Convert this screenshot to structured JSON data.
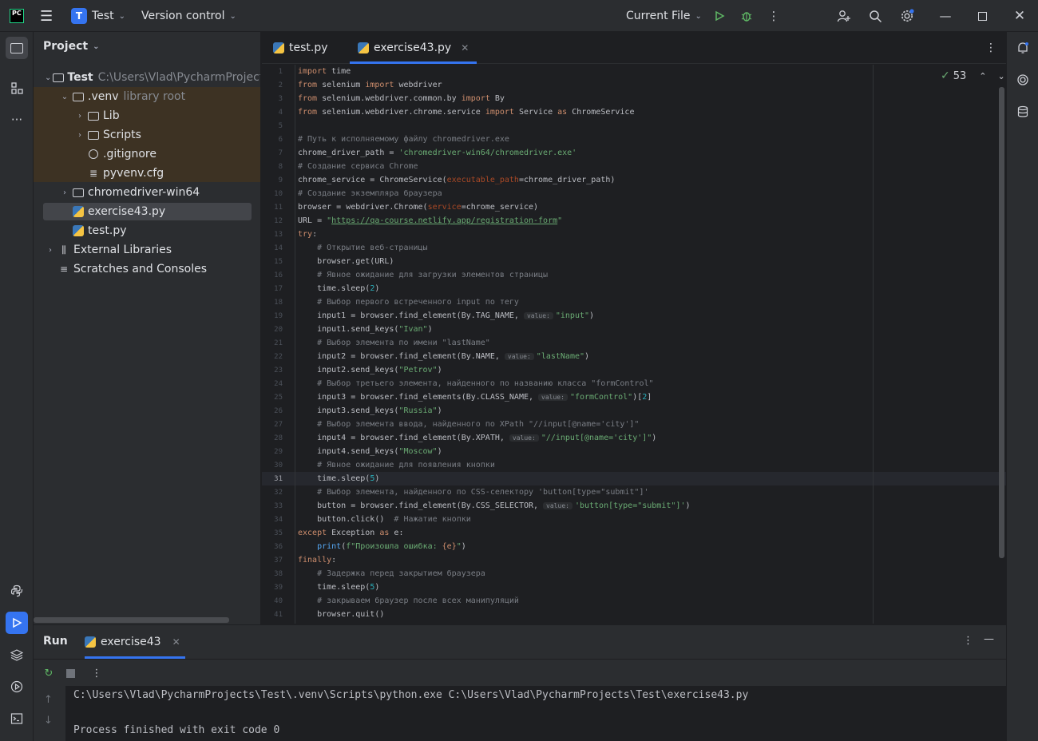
{
  "titlebar": {
    "logo": "PC",
    "project_badge": "T",
    "project_name": "Test",
    "vcs": "Version control",
    "run_config": "Current File"
  },
  "project_panel": {
    "header": "Project",
    "items": [
      {
        "label": "Test",
        "extra": "C:\\Users\\Vlad\\PycharmProjects\\Test"
      },
      {
        "label": ".venv",
        "extra": "library root"
      },
      {
        "label": "Lib"
      },
      {
        "label": "Scripts"
      },
      {
        "label": ".gitignore"
      },
      {
        "label": "pyvenv.cfg"
      },
      {
        "label": "chromedriver-win64"
      },
      {
        "label": "exercise43.py"
      },
      {
        "label": "test.py"
      },
      {
        "label": "External Libraries"
      },
      {
        "label": "Scratches and Consoles"
      }
    ]
  },
  "tabs": [
    {
      "label": "test.py"
    },
    {
      "label": "exercise43.py"
    }
  ],
  "editor": {
    "problems_count": "53",
    "current_line": 31,
    "line_numbers": [
      "1",
      "2",
      "3",
      "4",
      "5",
      "6",
      "7",
      "8",
      "9",
      "10",
      "11",
      "12",
      "13",
      "14",
      "15",
      "16",
      "17",
      "18",
      "19",
      "20",
      "21",
      "22",
      "23",
      "24",
      "25",
      "26",
      "27",
      "28",
      "29",
      "30",
      "31",
      "32",
      "33",
      "34",
      "35",
      "36",
      "37",
      "38",
      "39",
      "40",
      "41"
    ],
    "code": {
      "l1a": "import",
      "l1b": " time",
      "l2a": "from",
      "l2b": " selenium ",
      "l2c": "import",
      "l2d": " webdriver",
      "l3a": "from",
      "l3b": " selenium.webdriver.common.by ",
      "l3c": "import",
      "l3d": " By",
      "l4a": "from",
      "l4b": " selenium.webdriver.chrome.service ",
      "l4c": "import",
      "l4d": " Service ",
      "l4e": "as",
      "l4f": " ChromeService",
      "l6": "# Путь к исполняемому файлу chromedriver.exe",
      "l7a": "chrome_driver_path = ",
      "l7b": "'chromedriver-win64/chromedriver.exe'",
      "l8": "# Создание сервиса Chrome",
      "l9a": "chrome_service = ChromeService(",
      "l9b": "executable_path",
      "l9c": "=chrome_driver_path)",
      "l10": "# Создание экземпляра браузера",
      "l11a": "browser = webdriver.Chrome(",
      "l11b": "service",
      "l11c": "=chrome_service)",
      "l12a": "URL = ",
      "l12b": "\"",
      "l12c": "https://qa-course.netlify.app/registration-form",
      "l12d": "\"",
      "l13a": "try",
      "l13b": ":",
      "l14": "    # Открытие веб-страницы",
      "l15": "    browser.get(URL)",
      "l16": "    # Явное ожидание для загрузки элементов страницы",
      "l17a": "    time.sleep(",
      "l17b": "2",
      "l17c": ")",
      "l18": "    # Выбор первого встреченного input по тегу",
      "l19a": "    input1 = browser.find_element(By.TAG_NAME, ",
      "l19b": "value:",
      "l19c": "\"input\"",
      "l19d": ")",
      "l20a": "    input1.send_keys(",
      "l20b": "\"Ivan\"",
      "l20c": ")",
      "l21": "    # Выбор элемента по имени \"lastName\"",
      "l22a": "    input2 = browser.find_element(By.NAME, ",
      "l22b": "value:",
      "l22c": "\"lastName\"",
      "l22d": ")",
      "l23a": "    input2.send_keys(",
      "l23b": "\"Petrov\"",
      "l23c": ")",
      "l24": "    # Выбор третьего элемента, найденного по названию класса \"formControl\"",
      "l25a": "    input3 = browser.find_elements(By.CLASS_NAME, ",
      "l25b": "value:",
      "l25c": "\"formControl\"",
      "l25d": ")[",
      "l25e": "2",
      "l25f": "]",
      "l26a": "    input3.send_keys(",
      "l26b": "\"Russia\"",
      "l26c": ")",
      "l27": "    # Выбор элемента ввода, найденного по XPath \"//input[@name='city']\"",
      "l28a": "    input4 = browser.find_element(By.XPATH, ",
      "l28b": "value:",
      "l28c": "\"//input[@name='city']\"",
      "l28d": ")",
      "l29a": "    input4.send_keys(",
      "l29b": "\"Moscow\"",
      "l29c": ")",
      "l30": "    # Явное ожидание для появления кнопки",
      "l31a": "    time.sleep(",
      "l31b": "5",
      "l31c": ")",
      "l32": "    # Выбор элемента, найденного по CSS-селектору 'button[type=\"submit\"]'",
      "l33a": "    button = browser.find_element(By.CSS_SELECTOR, ",
      "l33b": "value:",
      "l33c": "'button[type=\"submit\"]'",
      "l33d": ")",
      "l34a": "    button.click()  ",
      "l34b": "# Нажатие кнопки",
      "l35a": "except",
      "l35b": " Exception ",
      "l35c": "as",
      "l35d": " e:",
      "l36a": "    ",
      "l36b": "print",
      "l36c": "(",
      "l36d": "f\"Произошла ошибка: ",
      "l36e": "{e}",
      "l36f": "\"",
      "l36g": ")",
      "l37a": "finally",
      "l37b": ":",
      "l38": "    # Задержка перед закрытием браузера",
      "l39a": "    time.sleep(",
      "l39b": "5",
      "l39c": ")",
      "l40": "    # закрываем браузер после всех манипуляций",
      "l41": "    browser.quit()"
    }
  },
  "run_panel": {
    "title": "Run",
    "tab": "exercise43",
    "output": [
      "C:\\Users\\Vlad\\PycharmProjects\\Test\\.venv\\Scripts\\python.exe C:\\Users\\Vlad\\PycharmProjects\\Test\\exercise43.py",
      "Process finished with exit code 0"
    ]
  },
  "colors": {
    "accent": "#3574f0",
    "keyword": "#cf8e6d",
    "string": "#6aab73",
    "number": "#2aacb8",
    "comment": "#7a7e85",
    "param": "#aa4926"
  }
}
